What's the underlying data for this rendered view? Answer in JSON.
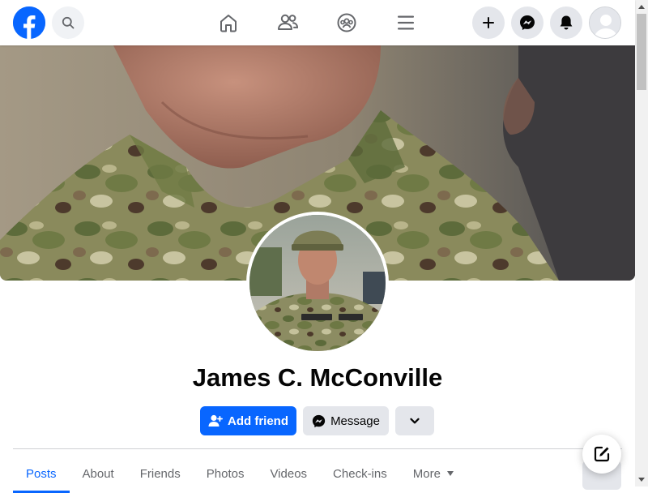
{
  "nav": {
    "logo_icon": "facebook-logo-icon",
    "search_icon": "search-icon",
    "center_icons": [
      "home-icon",
      "friends-icon",
      "groups-icon",
      "menu-icon"
    ],
    "right_icons": [
      "plus-icon",
      "messenger-icon",
      "bell-icon",
      "profile-avatar-icon"
    ]
  },
  "profile": {
    "name": "James C. McConville"
  },
  "actions": {
    "add_friend_label": "Add friend",
    "message_label": "Message",
    "more_icon": "chevron-down-icon"
  },
  "tabs": [
    {
      "label": "Posts",
      "active": true
    },
    {
      "label": "About",
      "active": false
    },
    {
      "label": "Friends",
      "active": false
    },
    {
      "label": "Photos",
      "active": false
    },
    {
      "label": "Videos",
      "active": false
    },
    {
      "label": "Check-ins",
      "active": false
    },
    {
      "label": "More",
      "active": false
    }
  ],
  "colors": {
    "accent": "#0866ff",
    "button_gray": "#e4e6eb",
    "text_primary": "#050505",
    "text_secondary": "#65676b"
  }
}
